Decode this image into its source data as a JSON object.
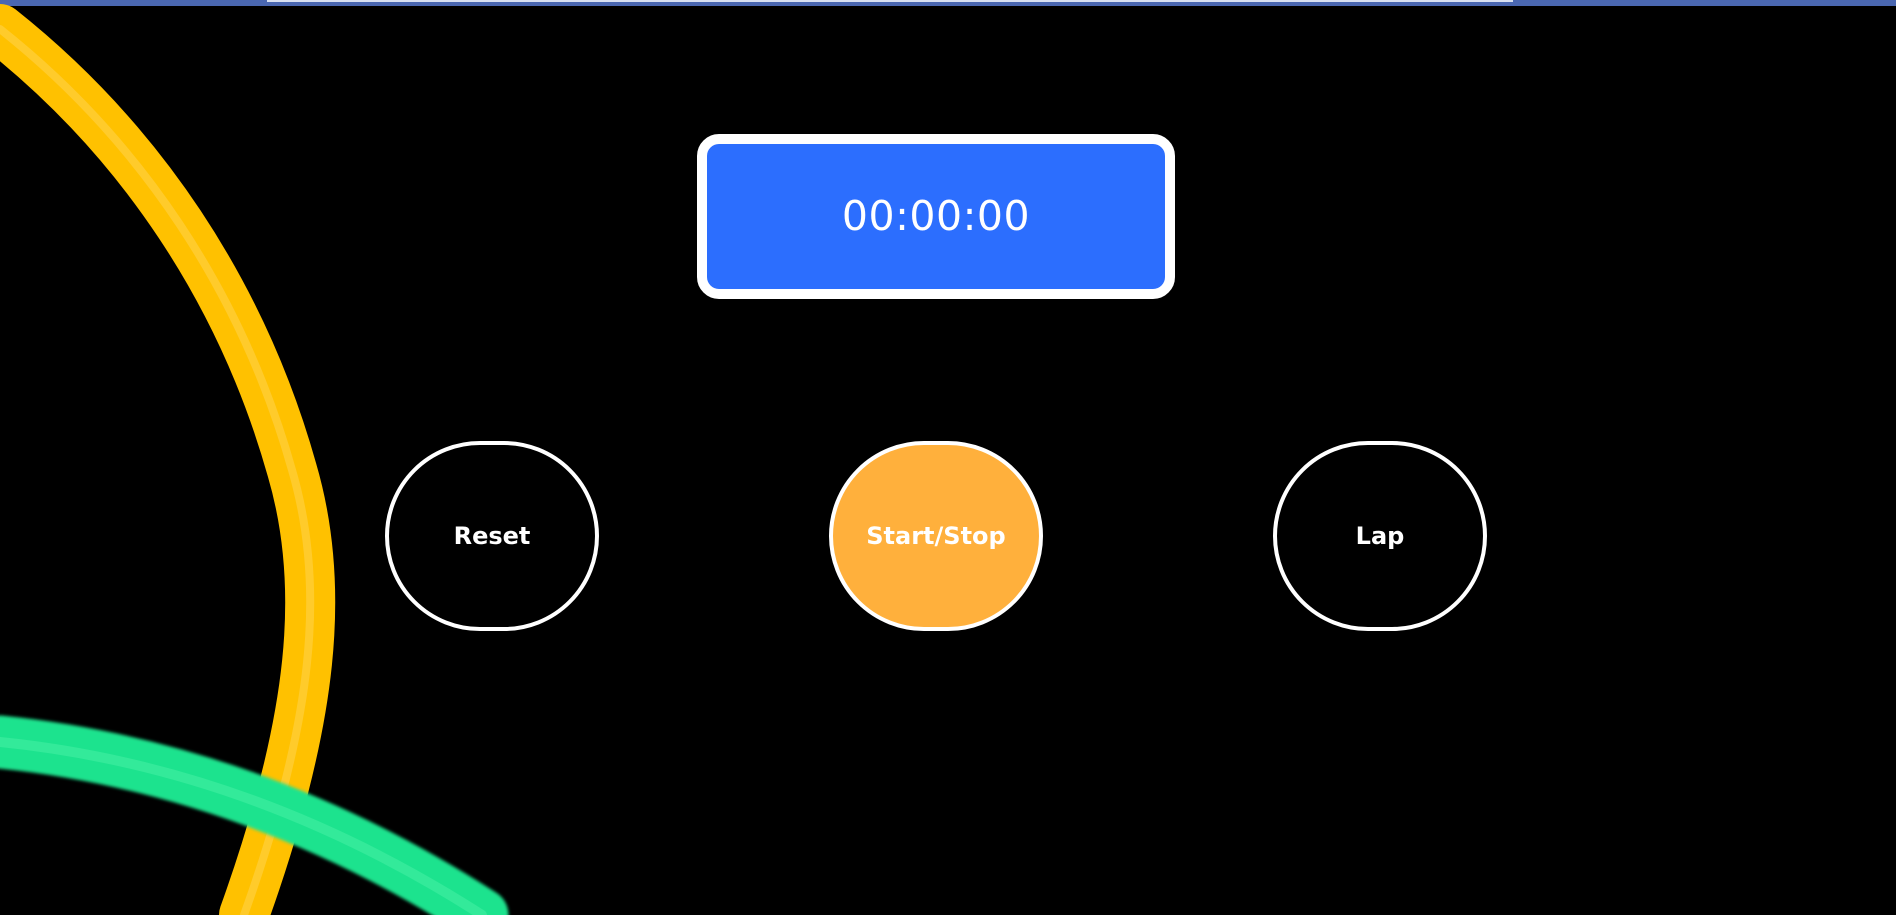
{
  "colors": {
    "background": "#000000",
    "timer_fill": "#2c6efe",
    "timer_border": "#ffffff",
    "start_stop_fill": "#ffb03c",
    "button_border": "#ffffff",
    "decoration_yellow": "#ffc100",
    "decoration_green": "#1ee38e",
    "top_strip": "#4a67b1"
  },
  "timer": {
    "display": "00:00:00"
  },
  "buttons": {
    "reset": "Reset",
    "start_stop": "Start/Stop",
    "lap": "Lap"
  }
}
